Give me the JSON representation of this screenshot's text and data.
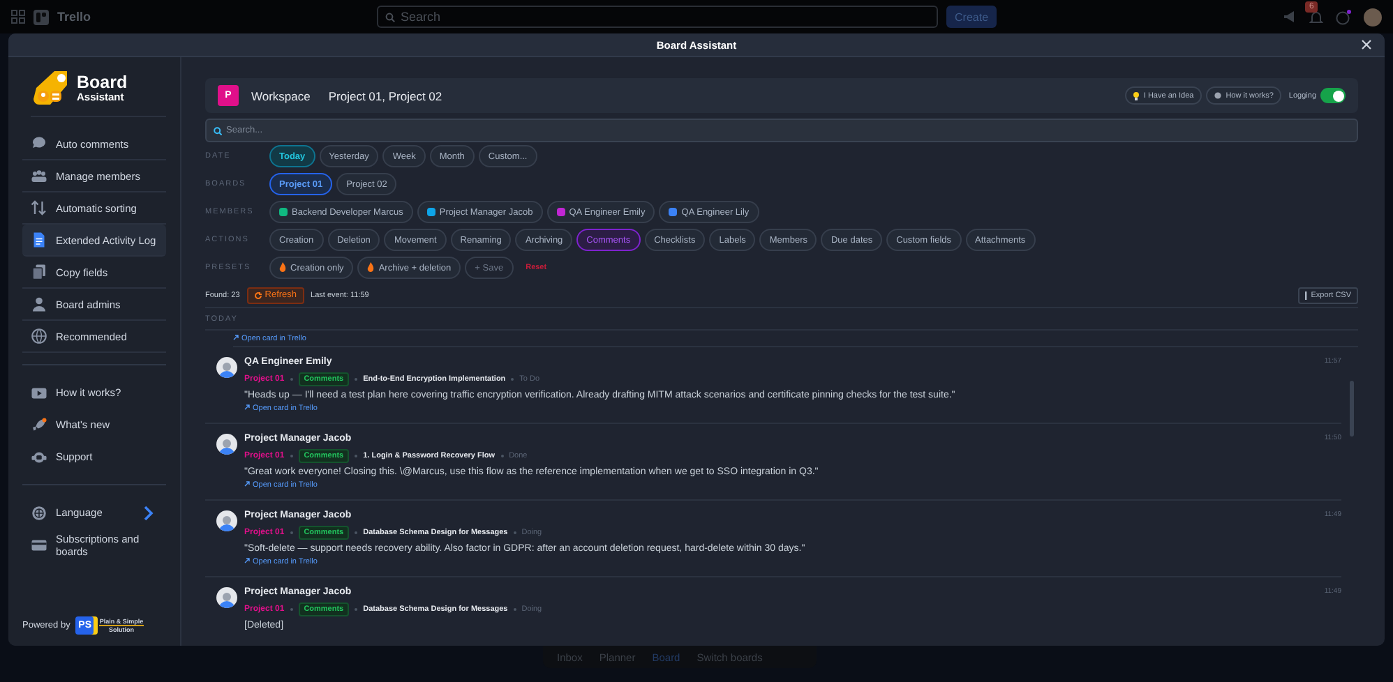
{
  "trello_bar": {
    "app_name": "Trello",
    "search_placeholder": "Search",
    "create_button": "Create",
    "notification_count": "6"
  },
  "window": {
    "title": "Board Assistant"
  },
  "sidebar": {
    "logo_title": "Board",
    "logo_subtitle": "Assistant",
    "groups": [
      [
        {
          "label": "Auto comments",
          "selected": false
        },
        {
          "label": "Manage members",
          "selected": false
        },
        {
          "label": "Automatic sorting",
          "selected": false
        },
        {
          "label": "Extended Activity Log",
          "selected": true
        },
        {
          "label": "Copy fields",
          "selected": false
        },
        {
          "label": "Board admins",
          "selected": false
        },
        {
          "label": "Recommended",
          "selected": false
        }
      ],
      [
        {
          "label": "How it works?",
          "selected": false
        },
        {
          "label": "What's new",
          "selected": false
        },
        {
          "label": "Support",
          "selected": false
        }
      ],
      [
        {
          "label": "Language",
          "selected": false
        },
        {
          "label": "Subscriptions and boards",
          "selected": false
        }
      ]
    ],
    "powered_by": "Powered by",
    "brand_letters": "PS",
    "brand_name": "Plain & Simple",
    "brand_tagline": "Solution"
  },
  "header": {
    "badge": "P",
    "workspace": "Workspace",
    "boards": "Project 01, Project 02",
    "buttons": [
      "I Have an Idea",
      "How it works?"
    ],
    "logging": {
      "label": "Logging",
      "on": true
    }
  },
  "search": {
    "placeholder": "Search..."
  },
  "filters": [
    {
      "kind": "date",
      "label": "DATE",
      "chips": [
        {
          "label": "Today",
          "selected": true
        },
        {
          "label": "Yesterday",
          "selected": false
        },
        {
          "label": "Week",
          "selected": false
        },
        {
          "label": "Month",
          "selected": false
        },
        {
          "label": "Custom...",
          "selected": false
        }
      ]
    },
    {
      "kind": "boards",
      "label": "BOARDS",
      "chips": [
        {
          "label": "Project 01",
          "selected": true
        },
        {
          "label": "Project 02",
          "selected": false
        }
      ]
    },
    {
      "kind": "members",
      "label": "MEMBERS",
      "chips": [
        {
          "label": "Backend Developer Marcus",
          "selected": false,
          "color": "#10b981"
        },
        {
          "label": "Project Manager Jacob",
          "selected": false,
          "color": "#0ea5e9"
        },
        {
          "label": "QA Engineer Emily",
          "selected": false,
          "color": "#c026d3"
        },
        {
          "label": "QA Engineer Lily",
          "selected": false,
          "color": "#3b82f6"
        }
      ]
    },
    {
      "kind": "actions",
      "label": "ACTIONS",
      "chips": [
        {
          "label": "Creation",
          "selected": false
        },
        {
          "label": "Deletion",
          "selected": false
        },
        {
          "label": "Movement",
          "selected": false
        },
        {
          "label": "Renaming",
          "selected": false
        },
        {
          "label": "Archiving",
          "selected": false
        },
        {
          "label": "Comments",
          "selected": true
        },
        {
          "label": "Checklists",
          "selected": false
        },
        {
          "label": "Labels",
          "selected": false
        },
        {
          "label": "Members",
          "selected": false
        },
        {
          "label": "Due dates",
          "selected": false
        },
        {
          "label": "Custom fields",
          "selected": false
        },
        {
          "label": "Attachments",
          "selected": false
        }
      ]
    },
    {
      "kind": "presets",
      "label": "PRESETS",
      "chips": [
        {
          "label": "Creation only",
          "kind": "preset"
        },
        {
          "label": "Archive + deletion",
          "kind": "preset"
        },
        {
          "label": "+ Save",
          "kind": "save"
        }
      ],
      "reset": "Reset"
    }
  ],
  "status": {
    "found": "Found: 23",
    "refresh": "Refresh",
    "last_event": "Last event: 11:59",
    "export": "Export CSV"
  },
  "log": {
    "section": "TODAY",
    "top_link": "Open card in Trello",
    "entries": [
      {
        "author": "QA Engineer Emily",
        "board": "Project 01",
        "action": "Comments",
        "card": "End-to-End Encryption Implementation",
        "list": "To Do",
        "text": "\"Heads up — I'll need a test plan here covering traffic encryption verification. Already drafting MITM attack scenarios and certificate pinning checks for the test suite.\"",
        "link": "Open card in Trello",
        "time": "11:57"
      },
      {
        "author": "Project Manager Jacob",
        "board": "Project 01",
        "action": "Comments",
        "card": "1. Login & Password Recovery Flow",
        "list": "Done",
        "text": "\"Great work everyone! Closing this. \\@Marcus, use this flow as the reference implementation when we get to SSO integration in Q3.\"",
        "link": "Open card in Trello",
        "time": "11:50"
      },
      {
        "author": "Project Manager Jacob",
        "board": "Project 01",
        "action": "Comments",
        "card": "Database Schema Design for Messages",
        "list": "Doing",
        "text": "\"Soft-delete — support needs recovery ability. Also factor in GDPR: after an account deletion request, hard-delete within 30 days.\"",
        "link": "Open card in Trello",
        "time": "11:49"
      },
      {
        "author": "Project Manager Jacob",
        "board": "Project 01",
        "action": "Comments",
        "card": "Database Schema Design for Messages",
        "list": "Doing",
        "text": "[Deleted]",
        "time": "11:49"
      }
    ]
  },
  "bottom_nav": [
    {
      "label": "Inbox",
      "selected": false
    },
    {
      "label": "Planner",
      "selected": false
    },
    {
      "label": "Board",
      "selected": true
    },
    {
      "label": "Switch boards",
      "selected": false
    }
  ]
}
